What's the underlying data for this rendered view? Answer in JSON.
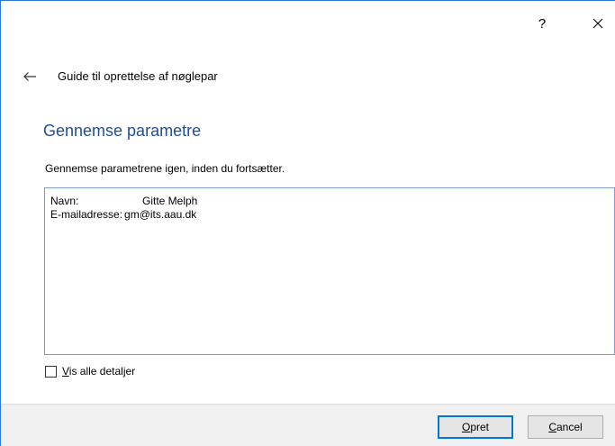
{
  "titlebar": {
    "help_label": "?",
    "close_icon": "close-icon"
  },
  "wizard": {
    "title": "Guide til oprettelse af nøglepar",
    "back_icon": "back-arrow-icon"
  },
  "page": {
    "heading": "Gennemse parametre",
    "instruction": "Gennemse parametrene igen, inden du fortsætter."
  },
  "params": [
    {
      "key": "Navn:",
      "value": "Gitte Melph"
    },
    {
      "key": "E-mailadresse:",
      "value": "gm@its.aau.dk"
    }
  ],
  "details_checkbox": {
    "label_mnemonic": "V",
    "label_rest": "is alle detaljer",
    "checked": false
  },
  "buttons": {
    "create_mnemonic": "O",
    "create_rest": "pret",
    "cancel_mnemonic": "C",
    "cancel_rest": "ancel"
  },
  "colors": {
    "heading": "#1e4e9a",
    "accent": "#0078d7",
    "footer_bg": "#f0f0f0"
  }
}
